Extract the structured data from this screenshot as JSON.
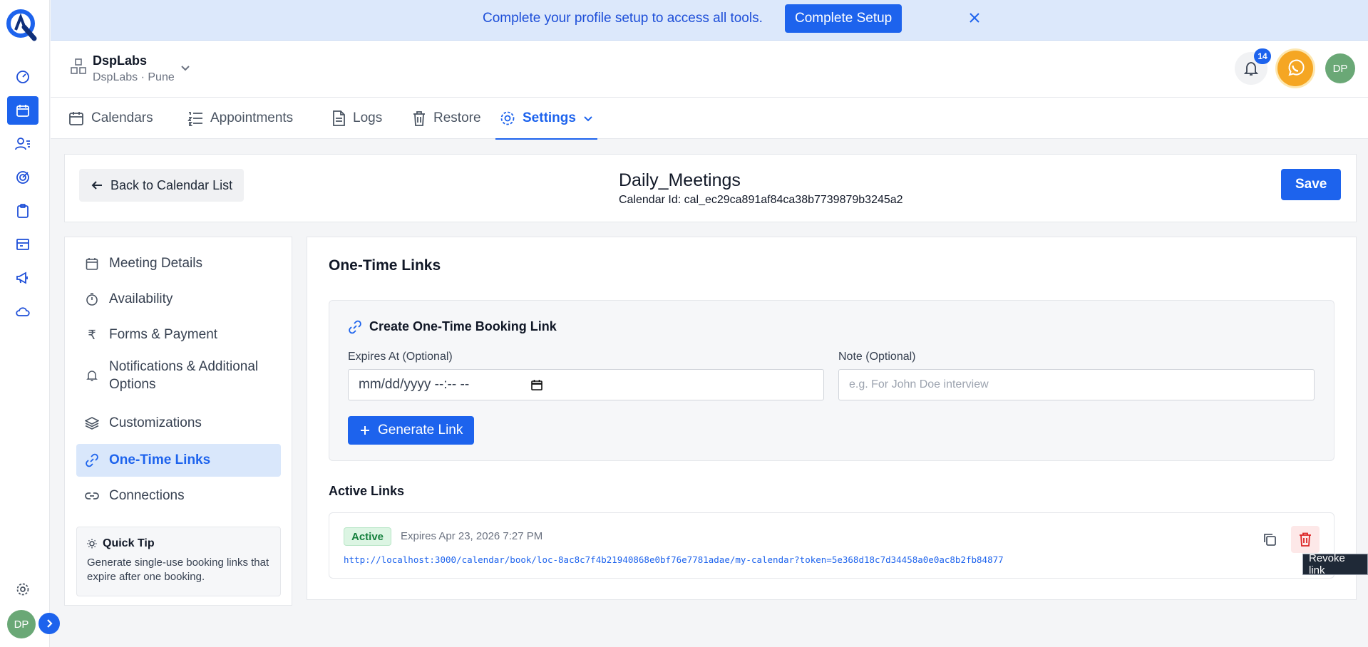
{
  "colors": {
    "accent": "#1d63ed",
    "success": "#15803d",
    "danger": "#dc2626",
    "warning": "#f5a623"
  },
  "rail": {
    "items": [
      "dashboard-icon",
      "calendar-icon",
      "contacts-icon",
      "target-icon",
      "clipboard-icon",
      "inbox-icon",
      "megaphone-icon",
      "cloud-icon"
    ],
    "settings_icon": "gear-icon",
    "avatar": "DP"
  },
  "banner": {
    "message": "Complete your profile setup to access all tools.",
    "button": "Complete Setup"
  },
  "header": {
    "org_name": "DspLabs",
    "org_sub": "DspLabs · Pune",
    "notification_count": "14",
    "avatar": "DP"
  },
  "tabs": [
    {
      "label": "Calendars",
      "icon": "calendar-icon"
    },
    {
      "label": "Appointments",
      "icon": "list-icon"
    },
    {
      "label": "Logs",
      "icon": "document-icon"
    },
    {
      "label": "Restore",
      "icon": "trash-icon"
    },
    {
      "label": "Settings",
      "icon": "gear-icon",
      "active": true
    }
  ],
  "titlebar": {
    "back_label": "Back to Calendar List",
    "title": "Daily_Meetings",
    "calendar_id": "Calendar Id: cal_ec29ca891af84ca38b7739879b3245a2",
    "save_label": "Save"
  },
  "sidemenu": {
    "items": [
      {
        "label": "Meeting Details",
        "icon": "calendar-icon"
      },
      {
        "label": "Availability",
        "icon": "stopwatch-icon"
      },
      {
        "label": "Forms & Payment",
        "icon": "rupee-icon"
      },
      {
        "label": "Notifications & Additional Options",
        "icon": "bell-icon"
      },
      {
        "label": "Customizations",
        "icon": "layers-icon"
      },
      {
        "label": "One-Time Links",
        "icon": "link-icon",
        "active": true
      },
      {
        "label": "Connections",
        "icon": "chain-icon"
      }
    ],
    "tip_title": "Quick Tip",
    "tip_body": "Generate single-use booking links that expire after one booking."
  },
  "main": {
    "heading": "One-Time Links",
    "create_title": "Create One-Time Booking Link",
    "expires_label": "Expires At (Optional)",
    "expires_value": "mm/dd/yyyy --:-- --",
    "note_label": "Note (Optional)",
    "note_placeholder": "e.g. For John Doe interview",
    "generate_label": "Generate Link",
    "active_heading": "Active Links",
    "links": [
      {
        "status": "Active",
        "expires": "Expires Apr 23, 2026 7:27 PM",
        "url": "http://localhost:3000/calendar/book/loc-8ac8c7f4b21940868e0bf76e7781adae/my-calendar?token=5e368d18c7d34458a0e0ac8b2fb84877"
      }
    ],
    "revoke_tooltip": "Revoke link"
  }
}
